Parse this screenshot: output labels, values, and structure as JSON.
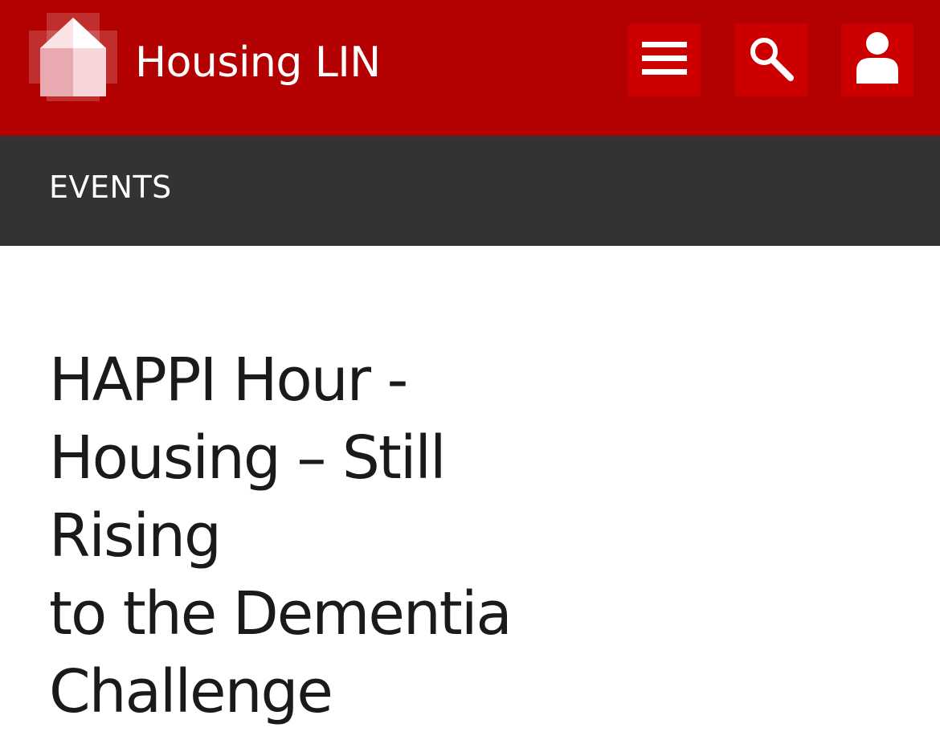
{
  "header": {
    "brand_name": "Housing LIN",
    "background_color": "#b30000",
    "button_color": "#cc0000",
    "logo_icon": "house-logo-icon",
    "buttons": [
      {
        "icon": "hamburger-menu-icon"
      },
      {
        "icon": "search-icon"
      },
      {
        "icon": "user-icon"
      }
    ]
  },
  "section": {
    "label": "EVENTS",
    "background_color": "#333333"
  },
  "main": {
    "title_lines": [
      "HAPPI Hour -",
      "Housing – Still Rising",
      "to the Dementia",
      "Challenge"
    ]
  }
}
